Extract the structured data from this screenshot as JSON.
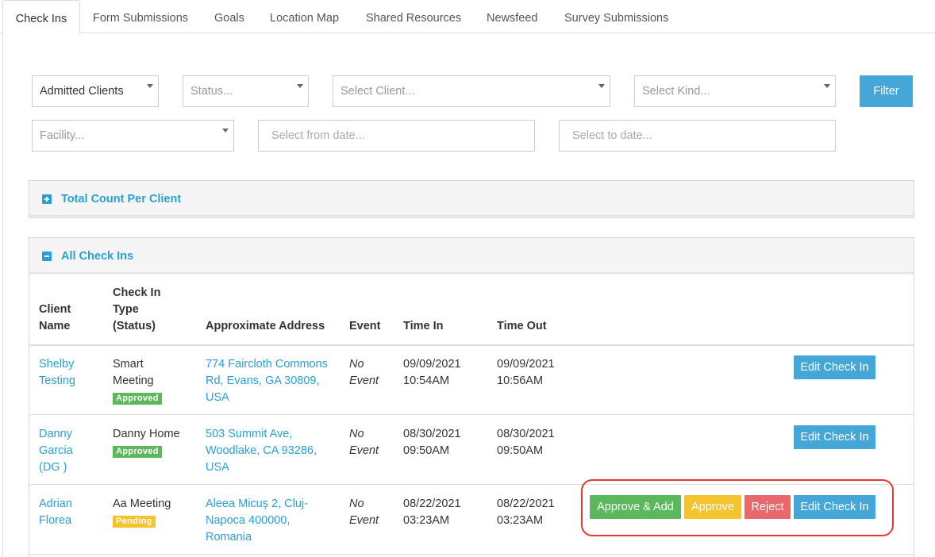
{
  "tabs": [
    "Check Ins",
    "Form Submissions",
    "Goals",
    "Location Map",
    "Shared Resources",
    "Newsfeed",
    "Survey Submissions"
  ],
  "filters": {
    "client_scope": "Admitted Clients",
    "status_placeholder": "Status...",
    "client_placeholder": "Select Client...",
    "kind_placeholder": "Select Kind...",
    "filter_button": "Filter",
    "facility_placeholder": "Facility...",
    "from_date_placeholder": "Select from date...",
    "to_date_placeholder": "Select to date..."
  },
  "panels": {
    "total_count": "Total Count Per Client",
    "all_check_ins": "All Check Ins"
  },
  "table": {
    "headers": {
      "client_name": [
        "Client",
        "Name"
      ],
      "type_status": [
        "Check In",
        "Type",
        "(Status)"
      ],
      "address": "Approximate Address",
      "event": "Event",
      "time_in": "Time In",
      "time_out": "Time Out"
    },
    "rows": [
      {
        "client": [
          "Shelby",
          "Testing"
        ],
        "type": [
          "Smart",
          "Meeting"
        ],
        "status": "Approved",
        "address": [
          "774 Faircloth Commons",
          "Rd, Evans, GA 30809,",
          "USA"
        ],
        "event": [
          "No",
          "Event"
        ],
        "time_in": [
          "09/09/2021",
          "10:54AM"
        ],
        "time_out": [
          "09/09/2021",
          "10:56AM"
        ]
      },
      {
        "client": [
          "Danny",
          "Garcia",
          "(DG )"
        ],
        "type": [
          "Danny Home"
        ],
        "status": "Approved",
        "address": [
          "503 Summit Ave,",
          "Woodlake, CA 93286,",
          "USA"
        ],
        "event": [
          "No",
          "Event"
        ],
        "time_in": [
          "08/30/2021",
          "09:50AM"
        ],
        "time_out": [
          "08/30/2021",
          "09:50AM"
        ]
      },
      {
        "client": [
          "Adrian",
          "Florea"
        ],
        "type": [
          "Aa Meeting"
        ],
        "status": "Pending",
        "address": [
          "Aleea Micuș 2, Cluj-",
          "Napoca 400000,",
          "Romania"
        ],
        "event": [
          "No",
          "Event"
        ],
        "time_in": [
          "08/22/2021",
          "03:23AM"
        ],
        "time_out": [
          "08/22/2021",
          "03:23AM"
        ]
      }
    ],
    "actions": {
      "edit": "Edit Check In",
      "approve_add": "Approve & Add",
      "approve": "Approve",
      "reject": "Reject"
    }
  },
  "colors": {
    "accent": "#2a9fd6",
    "button_blue": "#45a6d8",
    "approved_green": "#5cb85c",
    "pending_yellow": "#f4c430",
    "reject_red": "#e9686b",
    "highlight_red": "#e03c32"
  },
  "icons": {
    "total_count_toggle": "plus-square-icon",
    "all_check_ins_toggle": "minus-square-icon",
    "dropdown": "caret-down-icon"
  }
}
